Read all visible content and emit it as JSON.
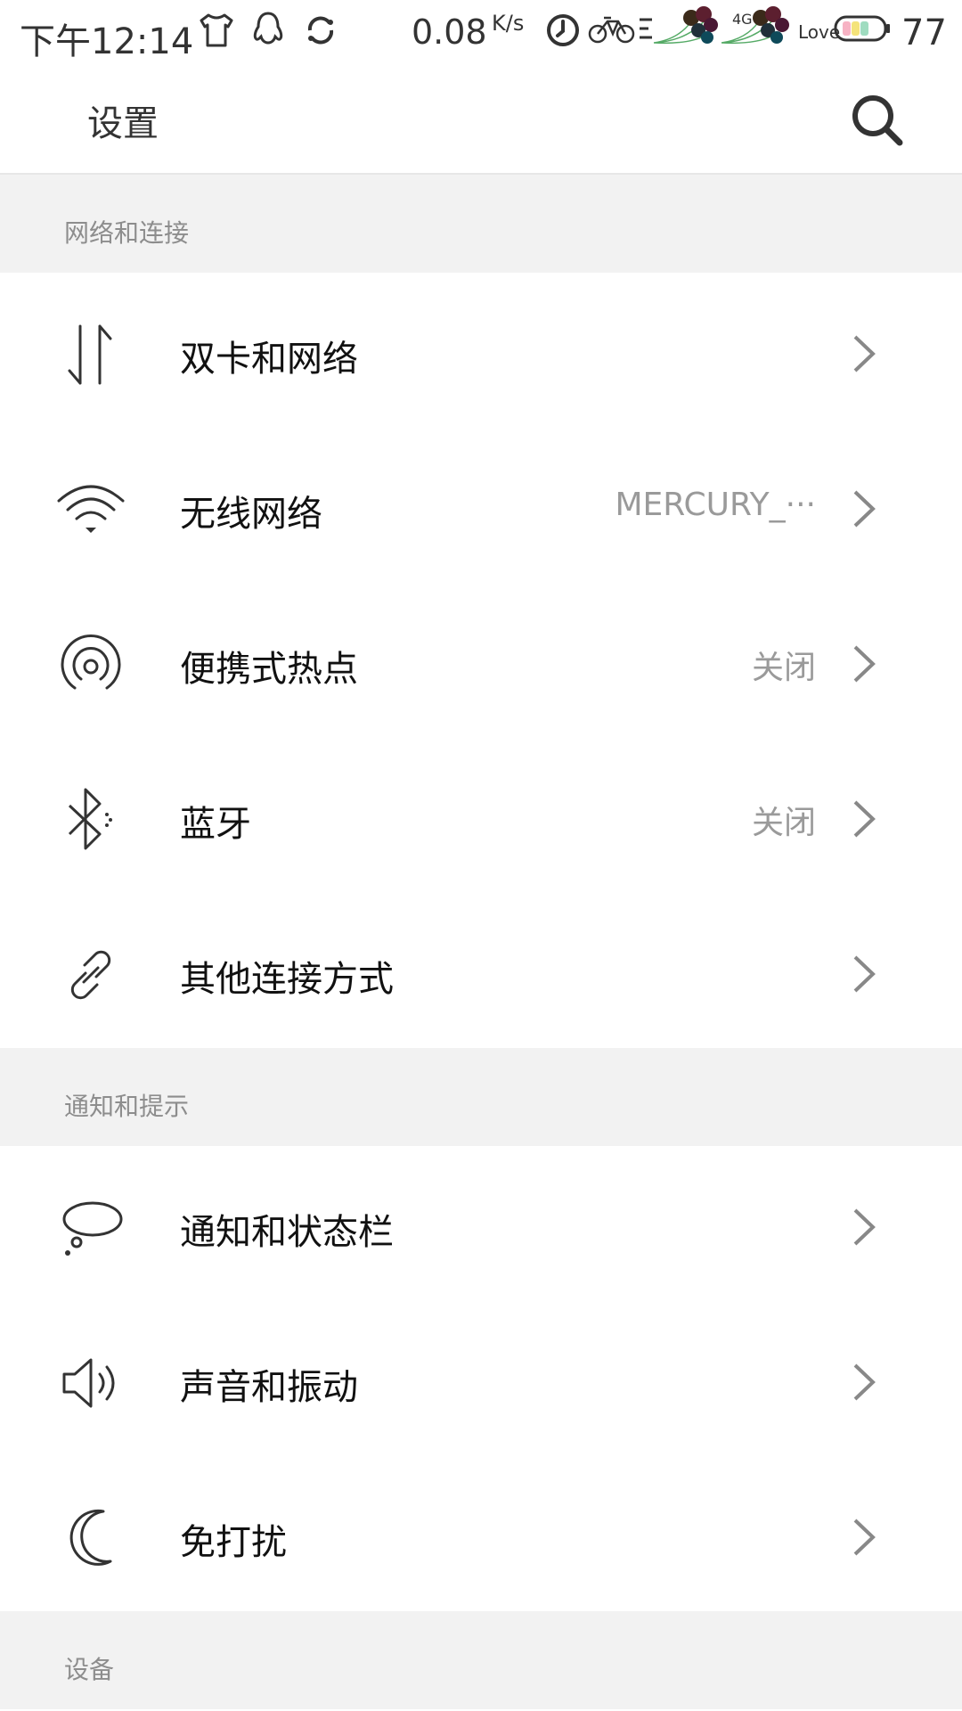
{
  "status_bar": {
    "time": "下午12:14",
    "net_speed": "0.08",
    "net_speed_unit": "K/s",
    "network_type": "4G",
    "love_label": "Love",
    "battery_level": "77"
  },
  "header": {
    "title": "设置"
  },
  "sections": [
    {
      "title": "网络和连接",
      "items": [
        {
          "label": "双卡和网络",
          "value": ""
        },
        {
          "label": "无线网络",
          "value": "MERCURY_···"
        },
        {
          "label": "便携式热点",
          "value": "关闭"
        },
        {
          "label": "蓝牙",
          "value": "关闭"
        },
        {
          "label": "其他连接方式",
          "value": ""
        }
      ]
    },
    {
      "title": "通知和提示",
      "items": [
        {
          "label": "通知和状态栏",
          "value": ""
        },
        {
          "label": "声音和振动",
          "value": ""
        },
        {
          "label": "免打扰",
          "value": ""
        }
      ]
    },
    {
      "title": "设备",
      "items": []
    }
  ],
  "colors": {
    "section_bg": "#f2f2f2",
    "section_text": "#8d8d8d",
    "value_text": "#9a9a9a",
    "icon_stroke": "#333333",
    "chevron": "#888888"
  }
}
